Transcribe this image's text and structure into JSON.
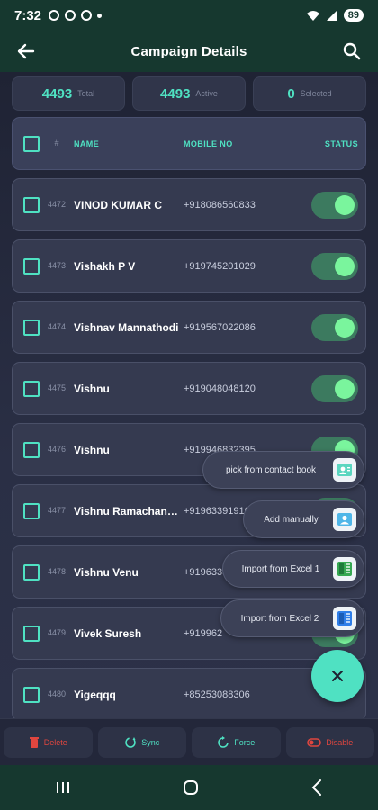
{
  "status_bar": {
    "time": "7:32",
    "battery": "89"
  },
  "appbar": {
    "title": "Campaign Details"
  },
  "stats": [
    {
      "value": "4493",
      "label": "Total"
    },
    {
      "value": "4493",
      "label": "Active"
    },
    {
      "value": "0",
      "label": "Selected"
    }
  ],
  "table_header": {
    "hash": "#",
    "name": "NAME",
    "mobile": "MOBILE NO",
    "status": "STATUS"
  },
  "rows": [
    {
      "index": "4472",
      "name": "VINOD KUMAR C",
      "mobile": "+918086560833",
      "active": true
    },
    {
      "index": "4473",
      "name": "Vishakh P V",
      "mobile": "+919745201029",
      "active": true
    },
    {
      "index": "4474",
      "name": "Vishnav Mannathodi",
      "mobile": "+919567022086",
      "active": true
    },
    {
      "index": "4475",
      "name": "Vishnu",
      "mobile": "+919048048120",
      "active": true
    },
    {
      "index": "4476",
      "name": "Vishnu",
      "mobile": "+919946832395",
      "active": true
    },
    {
      "index": "4477",
      "name": "Vishnu Ramachandran",
      "mobile": "+919633919107",
      "active": true
    },
    {
      "index": "4478",
      "name": "Vishnu Venu",
      "mobile": "+91963351",
      "active": true
    },
    {
      "index": "4479",
      "name": "Vivek Suresh",
      "mobile": "+919962",
      "active": true
    },
    {
      "index": "4480",
      "name": "Yigeqqq",
      "mobile": "+85253088306",
      "active": true
    }
  ],
  "fab_menu": [
    {
      "label": "pick from contact book",
      "icon": "contact-book-icon",
      "color": "#5bd6c0"
    },
    {
      "label": "Add manually",
      "icon": "add-person-icon",
      "color": "#4fb6e8"
    },
    {
      "label": "Import from Excel 1",
      "icon": "excel-green-icon",
      "color": "#36a852"
    },
    {
      "label": "Import from Excel 2",
      "icon": "excel-blue-icon",
      "color": "#2f7ee8"
    }
  ],
  "bottom_actions": [
    {
      "label": "Delete",
      "icon": "trash-icon",
      "color": "#e0463f"
    },
    {
      "label": "Sync",
      "icon": "sync-icon",
      "color": "#4fe1c2"
    },
    {
      "label": "Force",
      "icon": "force-refresh-icon",
      "color": "#4fe1c2"
    },
    {
      "label": "Disable",
      "icon": "toggle-off-icon",
      "color": "#e0463f"
    }
  ]
}
